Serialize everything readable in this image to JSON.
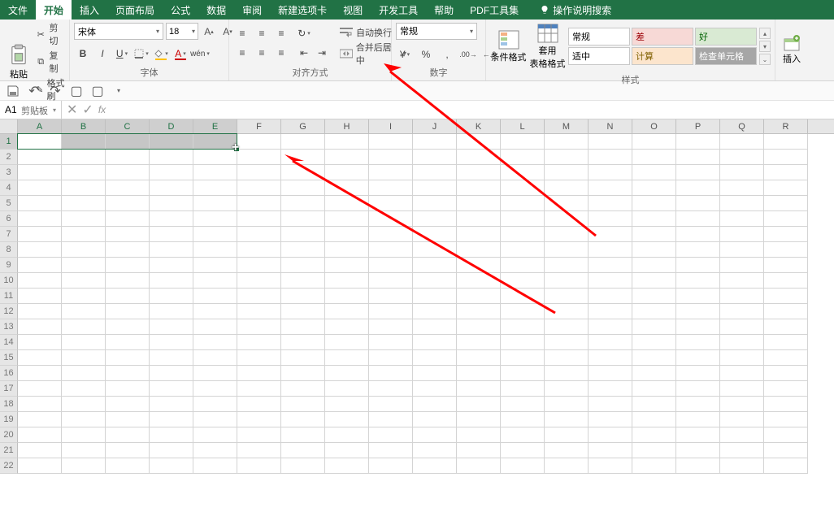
{
  "menubar": {
    "tabs": [
      "文件",
      "开始",
      "插入",
      "页面布局",
      "公式",
      "数据",
      "审阅",
      "新建选项卡",
      "视图",
      "开发工具",
      "帮助",
      "PDF工具集"
    ],
    "active_index": 1,
    "search_hint": "操作说明搜索"
  },
  "ribbon": {
    "clipboard": {
      "paste": "粘贴",
      "cut": "剪切",
      "copy": "复制",
      "format_painter": "格式刷",
      "label": "剪贴板"
    },
    "font": {
      "family": "宋体",
      "size": "18",
      "label": "字体"
    },
    "align": {
      "wrap": "自动换行",
      "merge": "合并后居中",
      "label": "对齐方式"
    },
    "number": {
      "format": "常规",
      "label": "数字"
    },
    "styles": {
      "cond_line1": "条件格式",
      "cond_line2": "",
      "table_line1": "套用",
      "table_line2": "表格格式",
      "chips": [
        "常规",
        "差",
        "好",
        "适中",
        "计算",
        "检查单元格"
      ],
      "label": "样式"
    },
    "cells": {
      "insert": "插入"
    }
  },
  "namebox": "A1",
  "selection": {
    "range": "A1:E1",
    "active": "A1"
  },
  "columns": [
    "A",
    "B",
    "C",
    "D",
    "E",
    "F",
    "G",
    "H",
    "I",
    "J",
    "K",
    "L",
    "M",
    "N",
    "O",
    "P",
    "Q",
    "R"
  ],
  "selected_cols": [
    "A",
    "B",
    "C",
    "D",
    "E"
  ],
  "rows": [
    1,
    2,
    3,
    4,
    5,
    6,
    7,
    8,
    9,
    10,
    11,
    12,
    13,
    14,
    15,
    16,
    17,
    18,
    19,
    20,
    21,
    22
  ]
}
